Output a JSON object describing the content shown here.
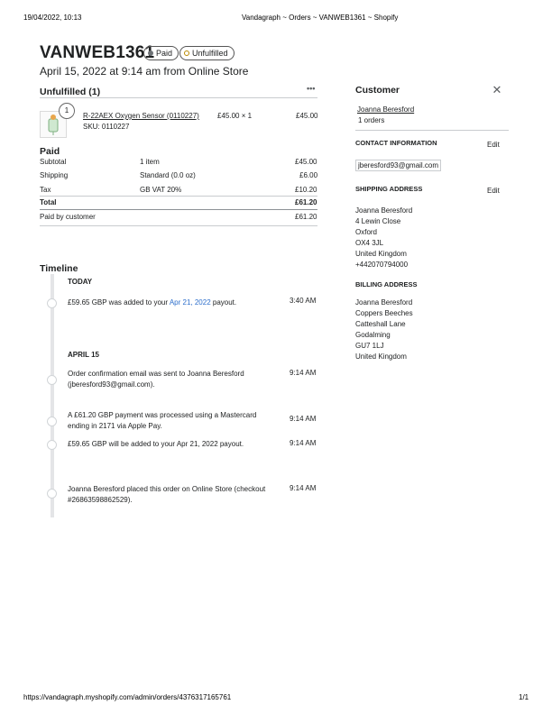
{
  "print_header": {
    "datetime": "19/04/2022, 10:13",
    "title": "Vandagraph ~ Orders ~ VANWEB1361 ~ Shopify"
  },
  "print_footer": {
    "url": "https://vandagraph.myshopify.com/admin/orders/4376317165761",
    "page": "1/1"
  },
  "order": {
    "id": "VANWEB1361",
    "badges": {
      "paid": "Paid",
      "unfulfilled": "Unfulfilled"
    },
    "subtitle": "April 15, 2022 at 9:14 am from Online Store"
  },
  "unfulfilled": {
    "title": "Unfulfilled (1)",
    "more_icon": "•••",
    "item": {
      "quantity_badge": "1",
      "name": "R-22AEX Oxygen Sensor (0110227)",
      "sku": "SKU: 0110227",
      "price_qty": "£45.00 × 1",
      "total": "£45.00"
    }
  },
  "paid": {
    "title": "Paid",
    "rows": [
      {
        "label": "Subtotal",
        "desc": "1 item",
        "value": "£45.00"
      },
      {
        "label": "Shipping",
        "desc": "Standard (0.0 oz)",
        "value": "£6.00"
      },
      {
        "label": "Tax",
        "desc": "GB VAT 20%",
        "value": "£10.20"
      },
      {
        "label": "Total",
        "desc": "",
        "value": "£61.20"
      }
    ],
    "paid_by_customer": {
      "label": "Paid by customer",
      "value": "£61.20"
    }
  },
  "timeline": {
    "title": "Timeline",
    "groups": [
      {
        "heading": "TODAY",
        "events": [
          {
            "text_before": "£59.65 GBP was added to your ",
            "link": "Apr 21, 2022",
            "text_after": " payout.",
            "time": "3:40 AM"
          }
        ]
      },
      {
        "heading": "APRIL 15",
        "events": [
          {
            "text": "Order confirmation email was sent to Joanna Beresford (jberesford93@gmail.com).",
            "time": "9:14 AM"
          },
          {
            "text": "A £61.20 GBP payment was processed using a Mastercard ending in 2171 via Apple Pay.",
            "time": "9:14 AM"
          },
          {
            "text": "£59.65 GBP will be added to your Apr 21, 2022 payout.",
            "time": "9:14 AM"
          },
          {
            "text": "Joanna Beresford placed this order on Online Store (checkout #26863598862529).",
            "time": "9:14 AM"
          }
        ]
      }
    ]
  },
  "customer": {
    "title": "Customer",
    "close_icon": "✕",
    "name": "Joanna Beresford",
    "orders": "1 orders",
    "contact": {
      "title": "CONTACT INFORMATION",
      "edit": "Edit",
      "email": "jberesford93@gmail.com"
    },
    "shipping": {
      "title": "SHIPPING ADDRESS",
      "edit": "Edit",
      "lines": [
        "Joanna Beresford",
        "4 Lewin Close",
        "Oxford",
        "OX4 3JL",
        "United Kingdom",
        "+442070794000"
      ]
    },
    "billing": {
      "title": "BILLING ADDRESS",
      "lines": [
        "Joanna Beresford",
        "Coppers Beeches",
        "Catteshall Lane",
        "Godalming",
        "GU7 1LJ",
        "United Kingdom"
      ]
    }
  }
}
